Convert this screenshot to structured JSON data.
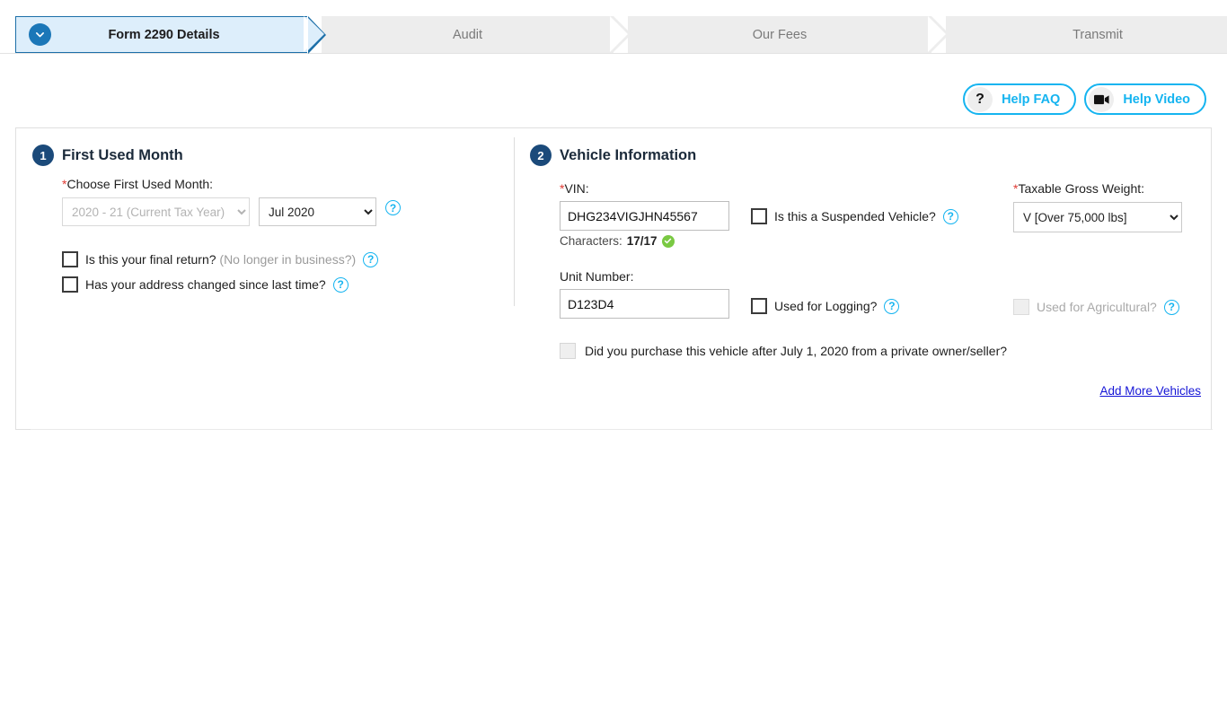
{
  "wizard": {
    "steps": [
      {
        "label": "Form 2290 Details",
        "state": "active",
        "icon": "chevron-down-icon"
      },
      {
        "label": "Audit",
        "state": "inactive"
      },
      {
        "label": "Our Fees",
        "state": "inactive"
      },
      {
        "label": "Transmit",
        "state": "inactive"
      }
    ]
  },
  "help": {
    "faq_label": "Help FAQ",
    "faq_icon": "question-mark-icon",
    "video_label": "Help Video",
    "video_icon": "video-camera-icon"
  },
  "section1": {
    "number": "1",
    "title": "First Used Month",
    "required_marker": "*",
    "choose_label": "Choose First Used Month:",
    "tax_year_value": "2020 - 21 (Current Tax Year)",
    "tax_year_disabled": true,
    "month_value": "Jul 2020",
    "help_icon": "question-circle-icon",
    "final_return_label": "Is this your final return?",
    "final_return_hint": "(No longer in business?)",
    "final_return_checked": false,
    "address_changed_label": "Has your address changed since last time?",
    "address_changed_checked": false
  },
  "section2": {
    "number": "2",
    "title": "Vehicle Information",
    "vin_label": "VIN:",
    "vin_value": "DHG234VIGJHN45567",
    "chars_label": "Characters:",
    "chars_count": "17/17",
    "chars_valid_icon": "green-check-icon",
    "suspended_label": "Is this a Suspended Vehicle?",
    "suspended_checked": false,
    "weight_label": "Taxable Gross Weight:",
    "weight_value": "V [Over 75,000 lbs]",
    "unit_label": "Unit Number:",
    "unit_value": "D123D4",
    "logging_label": "Used for Logging?",
    "logging_checked": false,
    "agricultural_label": "Used for Agricultural?",
    "agricultural_checked": false,
    "agricultural_disabled": true,
    "purchase_label": "Did you purchase this vehicle after July 1, 2020 from a private owner/seller?",
    "purchase_checked": false,
    "add_more_label": "Add More Vehicles"
  },
  "colors": {
    "accent_blue": "#1c6fa8",
    "badge_navy": "#1b4a7a",
    "cyan": "#15b4f0",
    "link_blue": "#1414d6",
    "required_red": "#e03b34",
    "green": "#7ac943"
  }
}
